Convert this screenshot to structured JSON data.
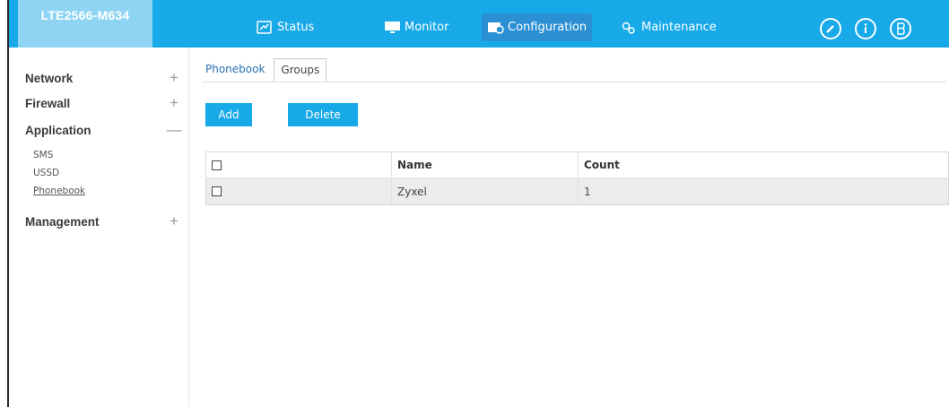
{
  "brand": {
    "model": "LTE2566-M634"
  },
  "topnav": {
    "status": "Status",
    "monitor": "Monitor",
    "configuration": "Configuration",
    "maintenance": "Maintenance",
    "icons": [
      "wizard-icon",
      "info-icon",
      "logout-icon"
    ]
  },
  "sidebar": {
    "network": "Network",
    "firewall": "Firewall",
    "application": "Application",
    "app_items": [
      "SMS",
      "USSD",
      "Phonebook"
    ],
    "management": "Management",
    "plus": "+",
    "minus": "—"
  },
  "tabs": {
    "phonebook": "Phonebook",
    "groups": "Groups"
  },
  "actions": {
    "add": "Add",
    "delete": "Delete"
  },
  "table": {
    "headers": [
      "",
      "Name",
      "Count"
    ],
    "rows": [
      {
        "name": "Zyxel",
        "count": "1"
      }
    ]
  },
  "colors": {
    "topbar": "#17a9e8",
    "brand_bg": "#8fd5f3",
    "active_nav": "#2b8fd3",
    "button": "#17a9e8"
  }
}
